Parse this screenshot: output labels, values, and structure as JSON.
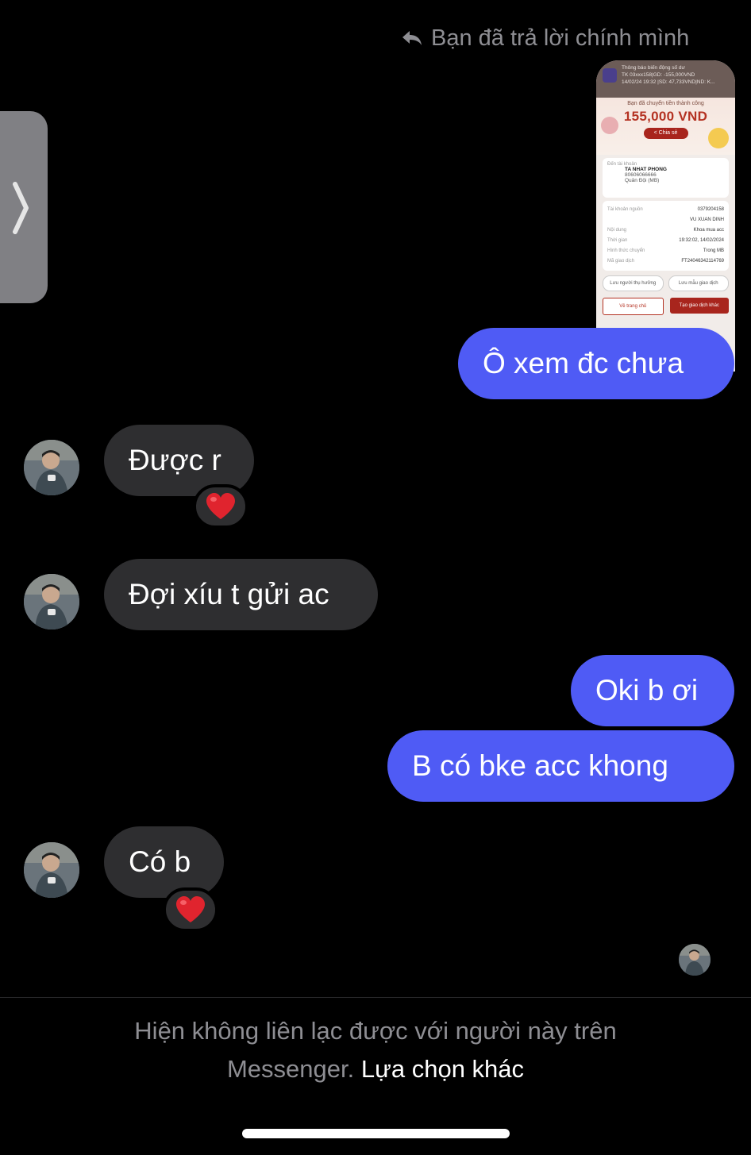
{
  "reply_header": {
    "text": "Bạn đã trả lời chính mình",
    "icon": "reply-arrow-icon"
  },
  "receipt": {
    "notification_title": "Thông báo biến động số dư",
    "notification_line1": "TK 03xxx158|GD: -155,000VND",
    "notification_line2": "14/02/24 19:32 |SD: 47,733VND|ND: K...",
    "success_text": "Bạn đã chuyển tiền thành công",
    "amount": "155,000 VND",
    "share_label": "Chia sẻ",
    "recipient_label": "Đến tài khoản",
    "recipient_name": "TA NHAT PHONG",
    "recipient_account": "80606066666",
    "recipient_bank": "Quân Đội (MB)",
    "rows": [
      {
        "label": "Tài khoản nguồn",
        "value": "0379204158"
      },
      {
        "label": "",
        "value": "VU XUAN DINH"
      },
      {
        "label": "Nội dung",
        "value": "Khoa mua acc"
      },
      {
        "label": "Thời gian",
        "value": "19:32:02, 14/02/2024"
      },
      {
        "label": "Hình thức chuyển",
        "value": "Trong MB"
      },
      {
        "label": "Mã giao dịch",
        "value": "FT24046342114769"
      }
    ],
    "save_beneficiary": "Lưu người thụ hưởng",
    "save_template": "Lưu mẫu giao dịch",
    "home_button": "Về trang chủ",
    "new_transaction_button": "Tạo giao dịch khác"
  },
  "messages": [
    {
      "id": "m1",
      "direction": "outgoing",
      "text": "Ô xem đc chưa"
    },
    {
      "id": "m2",
      "direction": "incoming",
      "text": "Được r",
      "reaction": "❤️"
    },
    {
      "id": "m3",
      "direction": "incoming",
      "text": "Đợi xíu t gửi ac"
    },
    {
      "id": "m4",
      "direction": "outgoing",
      "text": "Oki b ơi"
    },
    {
      "id": "m5",
      "direction": "outgoing",
      "text": "B có bke acc khong"
    },
    {
      "id": "m6",
      "direction": "incoming",
      "text": "Có b",
      "reaction": "❤️"
    }
  ],
  "footer": {
    "line1": "Hiện không liên lạc được với người này trên",
    "line2_prefix": "Messenger.",
    "link": "Lựa chọn khác"
  },
  "colors": {
    "outgoing": "#4f5bf5",
    "incoming": "#2e2e30",
    "background": "#000000",
    "muted": "#8e8e93",
    "heart": "#e0242e"
  }
}
